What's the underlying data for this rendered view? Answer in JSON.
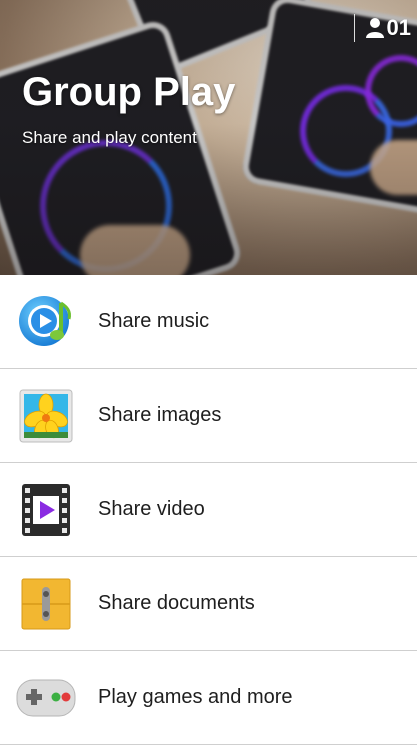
{
  "header": {
    "title": "Group Play",
    "subtitle": "Share and play content",
    "participant_count": "01"
  },
  "menu": {
    "items": [
      {
        "label": "Share music",
        "icon": "music-icon"
      },
      {
        "label": "Share images",
        "icon": "image-icon"
      },
      {
        "label": "Share video",
        "icon": "video-icon"
      },
      {
        "label": "Share documents",
        "icon": "documents-icon"
      },
      {
        "label": "Play games and more",
        "icon": "gamepad-icon"
      }
    ]
  },
  "colors": {
    "list_background": "#ffffff",
    "divider": "#cfcfcf",
    "title_text": "#ffffff"
  }
}
